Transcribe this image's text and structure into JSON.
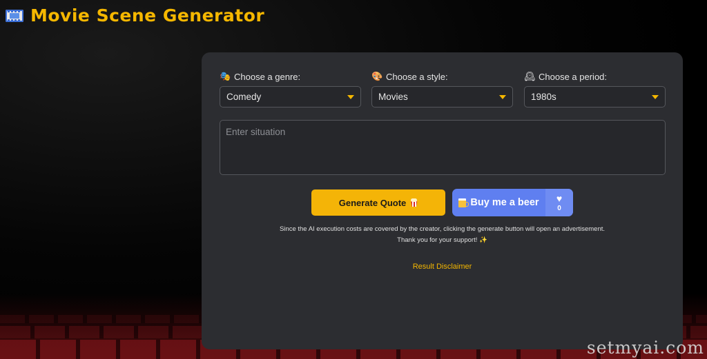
{
  "header": {
    "title": "Movie Scene Generator",
    "icon": "film-frames-icon"
  },
  "form": {
    "genre": {
      "label": "Choose a genre:",
      "icon": "performing-arts-icon",
      "emoji": "🎭",
      "value": "Comedy"
    },
    "style": {
      "label": "Choose a style:",
      "icon": "artist-palette-icon",
      "emoji": "🎨",
      "value": "Movies"
    },
    "period": {
      "label": "Choose a period:",
      "icon": "mantelpiece-clock-icon",
      "emoji": "🕰",
      "value": "1980s"
    },
    "situation": {
      "placeholder": "Enter situation",
      "value": ""
    }
  },
  "actions": {
    "generate_label": "Generate Quote",
    "beer_label": "Buy me a beer",
    "beer_count": "0"
  },
  "notice": {
    "line1": "Since the AI execution costs are covered by the creator, clicking the generate button will open an advertisement.",
    "line2": "Thank you for your support! ✨"
  },
  "disclaimer": "Result Disclaimer",
  "watermark": "setmyai.com",
  "colors": {
    "accent": "#f5b700",
    "card": "#2c2d31",
    "beer": "#5f7ff0"
  }
}
